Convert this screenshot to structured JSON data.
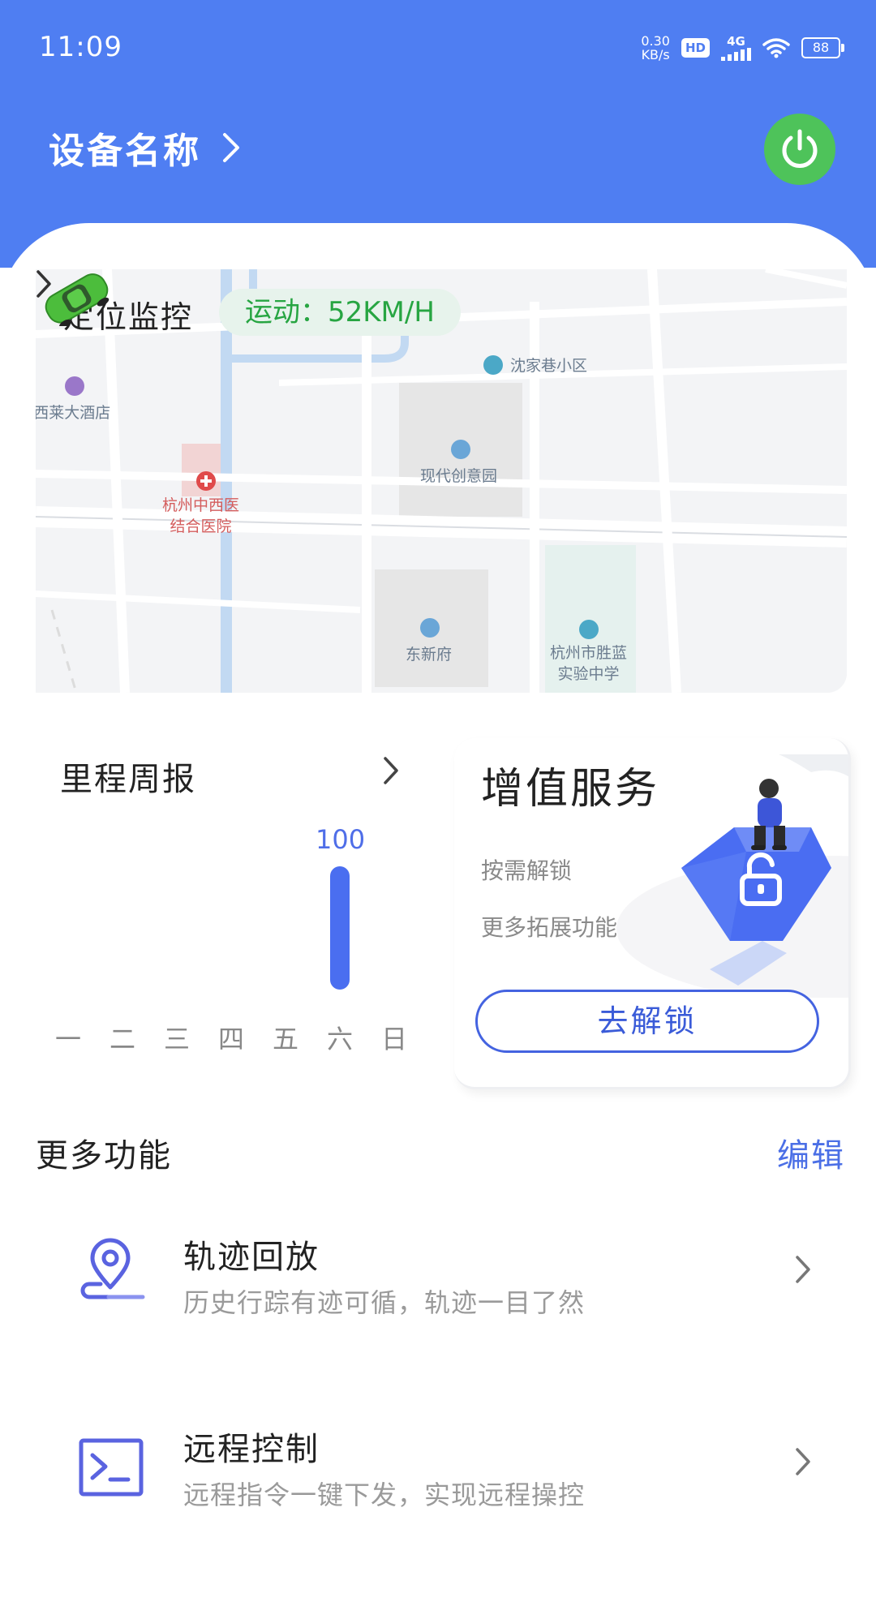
{
  "status_bar": {
    "time": "11:09",
    "net_speed_value": "0.30",
    "net_speed_unit": "KB/s",
    "hd": "HD",
    "network": "4G",
    "battery": "88"
  },
  "header": {
    "device_name": "设备名称",
    "power_color": "#4ec35a",
    "bg_color": "#4f7ef2"
  },
  "location": {
    "title": "定位监控",
    "speed": "运动：52KM/H",
    "pois": {
      "shenjiaxiang": "沈家巷小区",
      "xilai_hotel": "i西莱大酒店",
      "hospital_line1": "杭州中西医",
      "hospital_line2": "结合医院",
      "chuangyiyuan": "现代创意园",
      "dongxinfu": "东新府",
      "school_line1": "杭州市胜蓝",
      "school_line2": "实验中学"
    }
  },
  "mileage": {
    "title": "里程周报",
    "days": [
      "一",
      "二",
      "三",
      "四",
      "五",
      "六",
      "日"
    ],
    "values": [
      0,
      0,
      0,
      0,
      0,
      100,
      0
    ],
    "max": 100
  },
  "value_added": {
    "title": "增值服务",
    "line1": "按需解锁",
    "line2": "更多拓展功能",
    "button": "去解锁"
  },
  "more": {
    "title": "更多功能",
    "edit": "编辑",
    "items": [
      {
        "title": "轨迹回放",
        "desc": "历史行踪有迹可循，轨迹一目了然",
        "icon": "location-pin-icon"
      },
      {
        "title": "远程控制",
        "desc": "远程指令一键下发，实现远程操控",
        "icon": "terminal-icon"
      }
    ]
  }
}
